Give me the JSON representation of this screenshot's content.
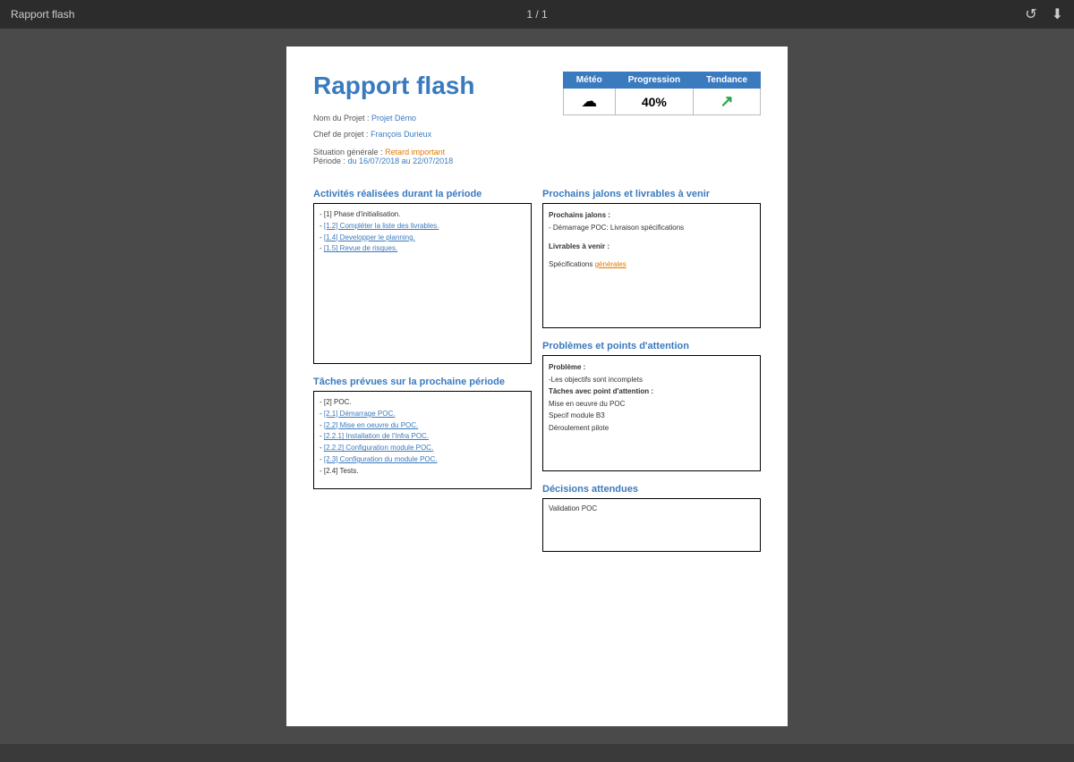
{
  "topbar": {
    "title": "Rapport flash",
    "pagination": "1 / 1",
    "refresh_icon": "↺",
    "download_icon": "⬇"
  },
  "document": {
    "title": "Rapport flash",
    "project_label": "Nom du Projet :",
    "project_value": "Projet Démo",
    "chef_label": "Chef de projet :",
    "chef_value": "François Durieux",
    "status_table": {
      "headers": [
        "Météo",
        "Progression",
        "Tendance"
      ],
      "weather_icon": "☁",
      "progress": "40%",
      "trend": "↗"
    },
    "situation_label": "Situation générale :",
    "situation_value": "Retard important",
    "periode_label": "Période :",
    "periode_value": "du 16/07/2018 au 22/07/2018",
    "activities_title": "Activités réalisées durant la période",
    "activities": [
      "- [1] Phase d'initialisation.",
      "- [1.2] Compléter la liste des livrables.",
      "- [1.4] Developper le planning.",
      "- [1.5] Revue de risques."
    ],
    "milestones_title": "Prochains jalons et livrables à venir",
    "milestones_sub": "Prochains jalons :",
    "milestones_items": [
      "- Démarrage POC: Livraison spécifications"
    ],
    "deliverables_sub": "Livrables à venir :",
    "deliverables_items": [],
    "deliverables_note": "Spécifications générales",
    "tasks_title": "Tâches prévues sur la prochaine période",
    "tasks": [
      "- [2] POC.",
      "- [2.1] Démarrage POC.",
      "- [2.2] Mise en oeuvre du POC.",
      "  - [2.2.1] Installation de l'Infra POC.",
      "  - [2.2.2] Configuration module POC.",
      "- [2.3] Configuration du module POC.",
      "- [2.4] Tests."
    ],
    "problems_title": "Problèmes et points d'attention",
    "problem_sub": "Problème :",
    "problem_items": [
      "-Les objectifs sont incomplets"
    ],
    "attention_sub": "Tâches avec point d'attention :",
    "attention_items": [
      "Mise en oeuvre du POC",
      "Specif module B3",
      "Déroulement pilote"
    ],
    "decisions_title": "Décisions attendues",
    "decisions": [
      "Validation POC"
    ]
  }
}
